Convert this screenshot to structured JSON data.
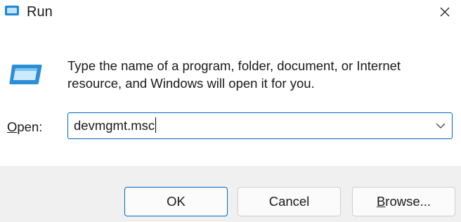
{
  "window": {
    "title": "Run",
    "icon": "run-icon",
    "close_icon": "close-icon"
  },
  "description": "Type the name of a program, folder, document, or Internet resource, and Windows will open it for you.",
  "open_field": {
    "label_mnemonic": "O",
    "label_rest": "pen:",
    "value": "devmgmt.msc",
    "dropdown_icon": "chevron-down-icon"
  },
  "buttons": {
    "ok": "OK",
    "cancel": "Cancel",
    "browse_mnemonic": "B",
    "browse_rest": "rowse..."
  },
  "colors": {
    "accent": "#0067c0",
    "footer_bg": "#f0f0f0"
  }
}
